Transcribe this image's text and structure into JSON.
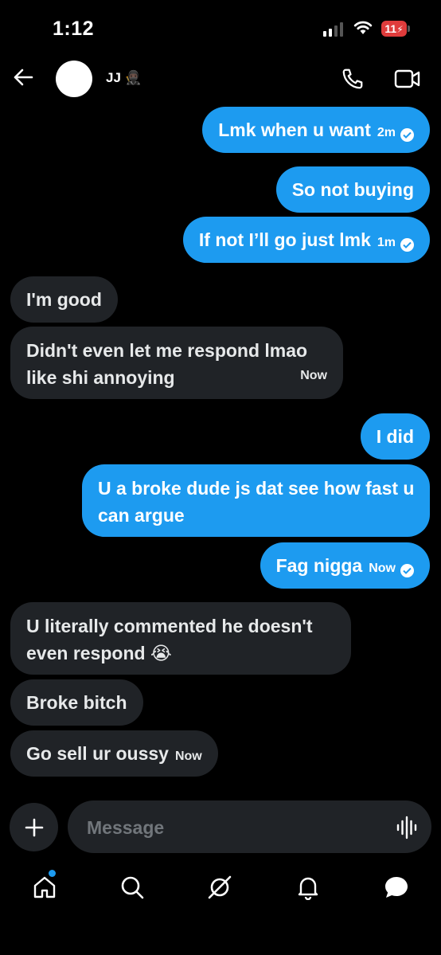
{
  "status_bar": {
    "time": "1:12",
    "battery": "11",
    "battery_color": "#e03c3c"
  },
  "header": {
    "back_icon": "arrow-left-icon",
    "avatar_emoji": "😍",
    "contact_name": "JJ 🥷🏿",
    "call_icon": "phone-icon",
    "video_icon": "video-camera-icon"
  },
  "messages": [
    {
      "direction": "outgoing",
      "text": "Lmk when u want",
      "time": "2m",
      "read": true
    },
    {
      "direction": "outgoing",
      "text": "So not buying"
    },
    {
      "direction": "outgoing",
      "text": "If not I’ll go just lmk",
      "time": "1m",
      "read": true
    },
    {
      "direction": "incoming",
      "text": "I'm good"
    },
    {
      "direction": "incoming",
      "text": "Didn't even let me respond lmao like shi annoying",
      "time": "Now"
    },
    {
      "direction": "outgoing",
      "text": "I did"
    },
    {
      "direction": "outgoing",
      "text": "U a broke dude js dat see how fast u can argue"
    },
    {
      "direction": "outgoing",
      "text": "Fag nigga",
      "time": "Now",
      "read": true
    },
    {
      "direction": "incoming",
      "text": "U literally commented he doesn't even respond 😭"
    },
    {
      "direction": "incoming",
      "text": "Broke bitch"
    },
    {
      "direction": "incoming",
      "text": "Go sell ur oussy",
      "time": "Now"
    }
  ],
  "composer": {
    "placeholder": "Message",
    "add_icon": "plus-icon",
    "voice_icon": "voice-waveform-icon"
  },
  "tab_bar": {
    "items": [
      "home-icon",
      "search-icon",
      "grok-icon",
      "notifications-bell-icon",
      "messages-icon"
    ],
    "active": "messages-icon",
    "home_badge": true
  },
  "colors": {
    "outgoing_bubble": "#1d9bf0",
    "incoming_bubble": "#202327",
    "background": "#000000",
    "placeholder": "#71767b"
  }
}
